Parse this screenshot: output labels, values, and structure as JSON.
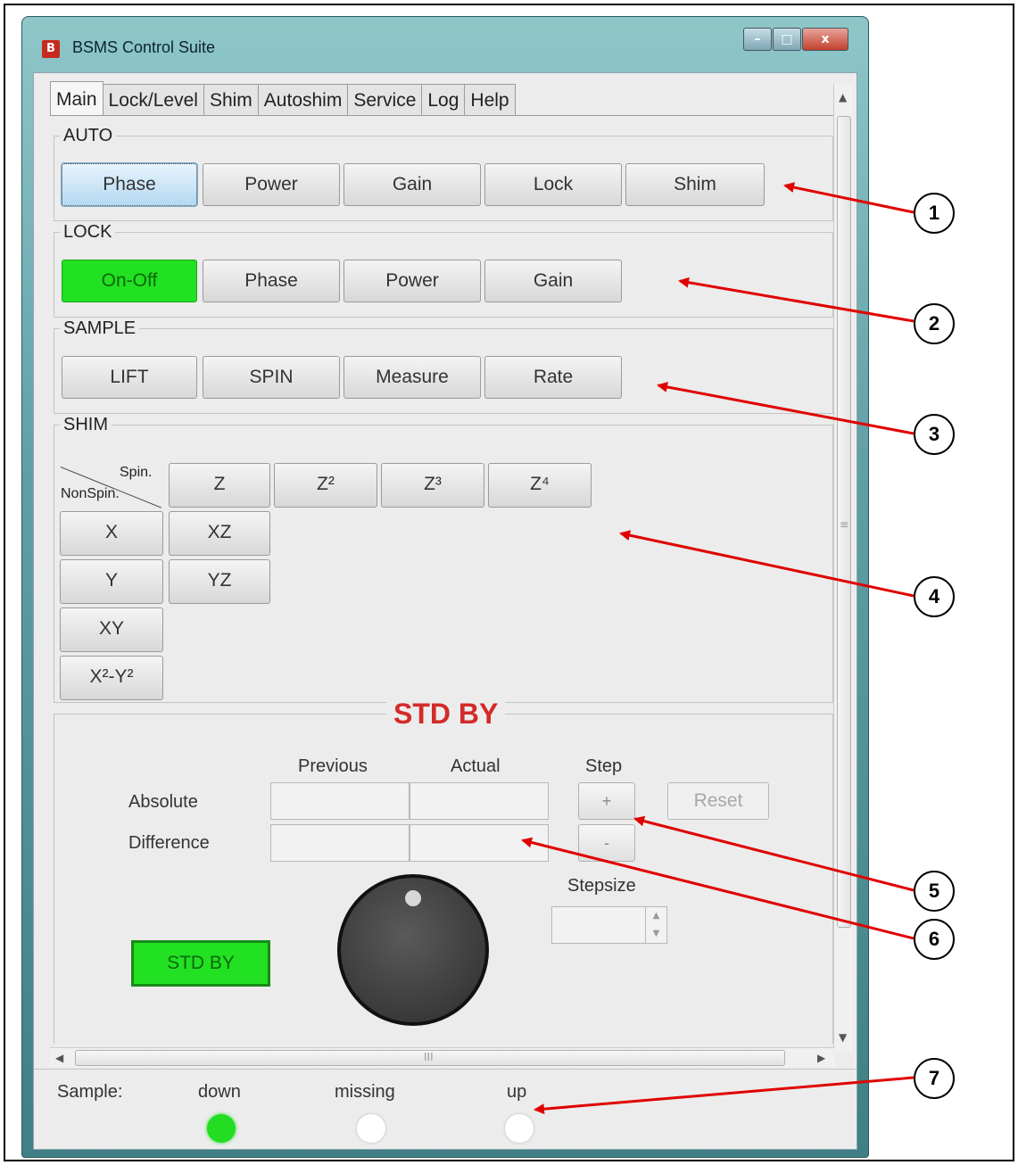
{
  "window": {
    "logo": "B",
    "title": "BSMS Control Suite",
    "minimize": "–",
    "maximize": "□",
    "close": "x"
  },
  "tabs": [
    "Main",
    "Lock/Level",
    "Shim",
    "Autoshim",
    "Service",
    "Log",
    "Help"
  ],
  "active_tab": "Main",
  "auto": {
    "title": "AUTO",
    "buttons": [
      "Phase",
      "Power",
      "Gain",
      "Lock",
      "Shim"
    ]
  },
  "lock": {
    "title": "LOCK",
    "buttons": [
      "On-Off",
      "Phase",
      "Power",
      "Gain"
    ]
  },
  "sample": {
    "title": "SAMPLE",
    "buttons": [
      "LIFT",
      "SPIN",
      "Measure",
      "Rate"
    ]
  },
  "shim": {
    "title": "SHIM",
    "spin_label": "Spin.",
    "nonspin_label": "NonSpin.",
    "spin_buttons": [
      "Z",
      "Z²",
      "Z³",
      "Z⁴"
    ],
    "nonspin_buttons": [
      "X",
      "XZ",
      "Y",
      "YZ",
      "XY",
      "X²-Y²"
    ]
  },
  "stdby": {
    "title": "STD BY",
    "col_previous": "Previous",
    "col_actual": "Actual",
    "col_step": "Step",
    "row_absolute": "Absolute",
    "row_difference": "Difference",
    "step_plus": "+",
    "step_minus": "-",
    "reset": "Reset",
    "stepsize_label": "Stepsize",
    "button": "STD BY"
  },
  "scroll": {
    "up": "▲",
    "down": "▼",
    "left": "◀",
    "right": "▶",
    "vgrip": "≡",
    "hgrip": "III"
  },
  "status": {
    "label": "Sample:",
    "indicators": [
      {
        "label": "down",
        "color": "#22dd22"
      },
      {
        "label": "missing",
        "color": "#ffffff"
      },
      {
        "label": "up",
        "color": "#ffffff"
      }
    ]
  },
  "callouts": [
    "1",
    "2",
    "3",
    "4",
    "5",
    "6",
    "7"
  ],
  "colors": {
    "accent_green": "#22e022",
    "stdby_red": "#d42a2a",
    "arrow_red": "#e00000"
  }
}
